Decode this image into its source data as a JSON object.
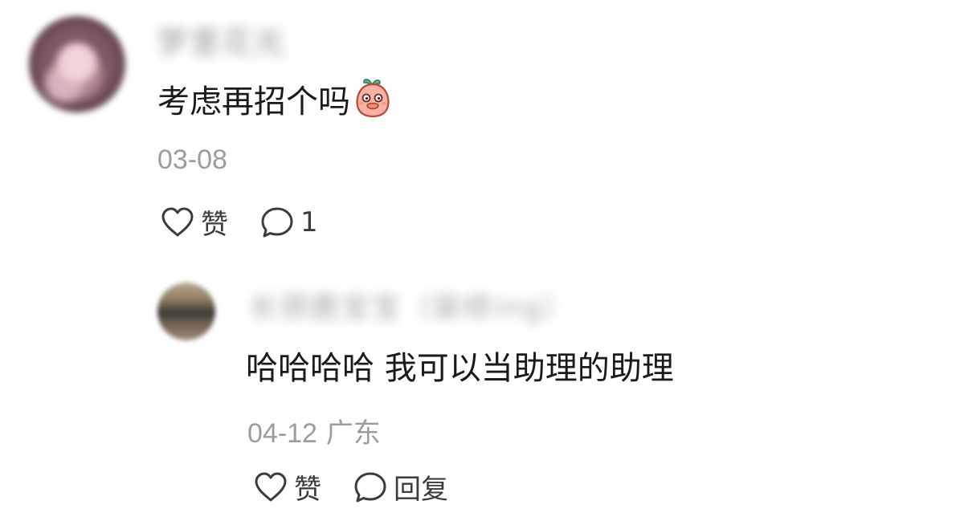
{
  "comment": {
    "author": "梦里花光",
    "text": "考虑再招个吗",
    "emoji": "peach-cover-mouth-emoji",
    "date": "03-08",
    "like_label": "赞",
    "reply_count": "1"
  },
  "reply": {
    "author": "长颈鹿宝宝（装修ing）",
    "text": "哈哈哈哈 我可以当助理的助理",
    "date": "04-12",
    "location": "广东",
    "like_label": "赞",
    "reply_label": "回复"
  },
  "colors": {
    "text_primary": "#1a1a1a",
    "text_secondary": "#9c9c9c",
    "icon": "#3b3b3b",
    "background": "#ffffff"
  }
}
